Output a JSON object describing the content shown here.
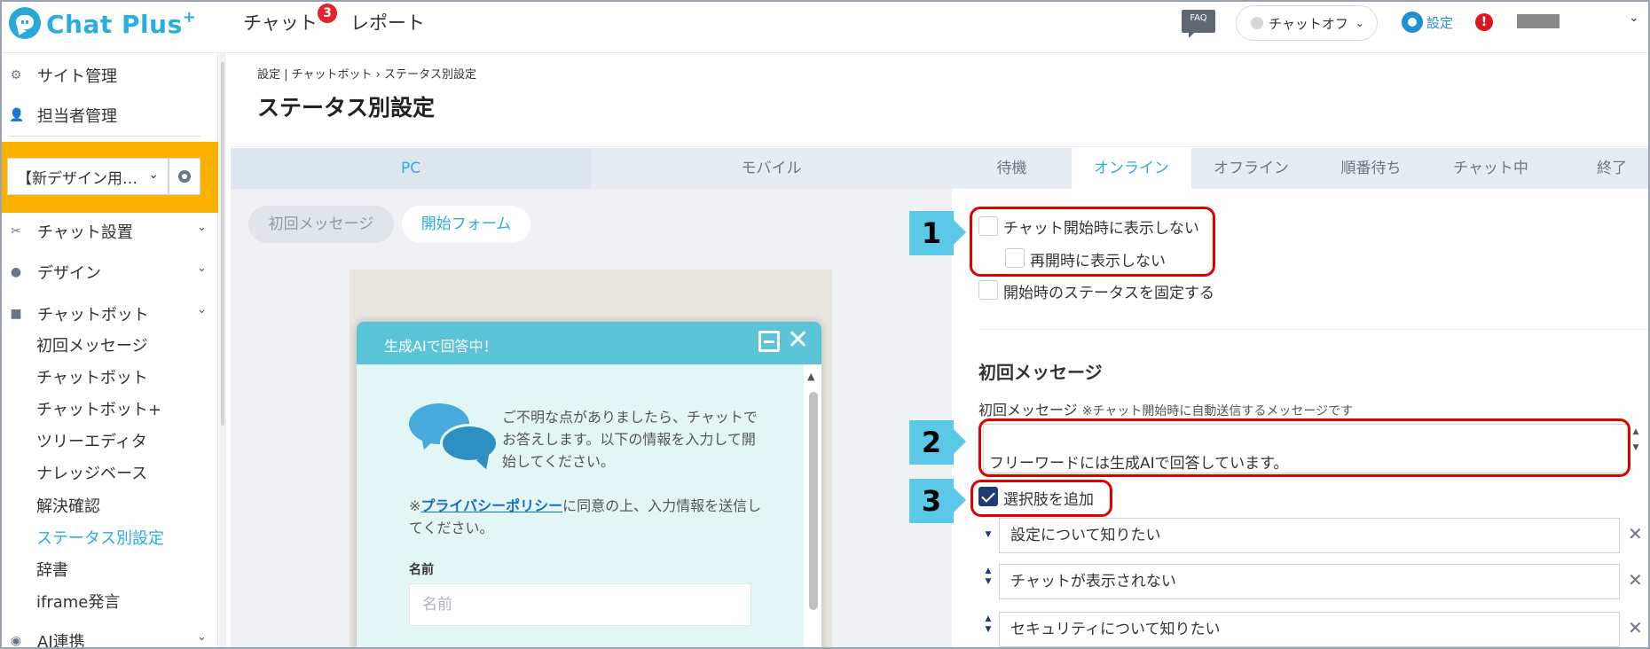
{
  "header": {
    "logo_text": "Chat Plus",
    "logo_plus": "+",
    "nav_chat": "チャット",
    "nav_chat_badge": "3",
    "nav_report": "レポート",
    "faq": "FAQ",
    "status": "チャットオフ",
    "settings": "設定",
    "alert": "!"
  },
  "sidebar": {
    "site_admin": "サイト管理",
    "staff_admin": "担当者管理",
    "site_select": "【新デザイン用…",
    "chat_settings": "チャット設置",
    "design": "デザイン",
    "chatbot": "チャットボット",
    "sub_items": [
      "初回メッセージ",
      "チャットボット",
      "チャットボット+",
      "ツリーエディタ",
      "ナレッジベース",
      "解決確認",
      "ステータス別設定",
      "辞書",
      "iframe発言"
    ],
    "active_sub": "ステータス別設定",
    "ai": "AI連携"
  },
  "page": {
    "breadcrumb": "設定 | チャットボット  ›  ステータス別設定",
    "title": "ステータス別設定"
  },
  "preview": {
    "tab_pc": "PC",
    "tab_mobile": "モバイル",
    "pill_first": "初回メッセージ",
    "pill_form": "開始フォーム",
    "widget_title": "生成AIで回答中！",
    "intro": "ご不明な点がありましたら、チャットでお答えします。以下の情報を入力して開始してください。",
    "privacy_prefix": "※",
    "privacy_link": "プライバシーポリシー",
    "privacy_suffix": "に同意の上、入力情報を送信してください。",
    "name_label": "名前",
    "name_placeholder": "名前"
  },
  "status_tabs": [
    "待機",
    "オンライン",
    "オフライン",
    "順番待ち",
    "チャット中",
    "終了"
  ],
  "active_status_tab": "オンライン",
  "settings": {
    "hide_on_start": "チャット開始時に表示しない",
    "hide_on_reopen": "再開時に表示しない",
    "fix_status": "開始時のステータスを固定する",
    "section_title": "初回メッセージ",
    "field_label": "初回メッセージ",
    "field_note": "※チャット開始時に自動送信するメッセージです",
    "message": "フリーワードには生成AIで回答しています。",
    "add_choices": "選択肢を追加",
    "add_choices_checked": true,
    "choices": [
      "設定について知りたい",
      "チャットが表示されない",
      "セキュリティについて知りたい"
    ]
  },
  "annotations": [
    "1",
    "2",
    "3"
  ],
  "colors": {
    "brand": "#2aaee0",
    "highlight": "#fbb100",
    "widget_header": "#5bc4d9",
    "callout": "#5bc8e8",
    "annotation_border": "#e00000"
  }
}
